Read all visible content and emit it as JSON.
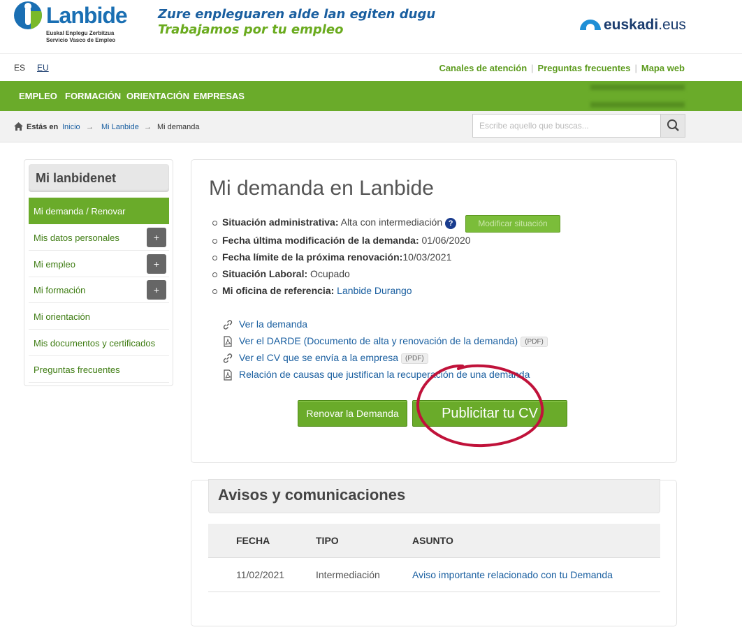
{
  "header": {
    "logo_word": "Lanbide",
    "logo_sub1": "Euskal Enplegu Zerbitzua",
    "logo_sub2": "Servicio Vasco de Empleo",
    "slogan_eu": "Zure enpleguaren alde lan egiten dugu",
    "slogan_es": "Trabajamos por tu empleo",
    "euskadi_bold": "euskadi",
    "euskadi_tld": ".eus"
  },
  "toplinks": {
    "lang_es": "ES",
    "lang_eu": "EU",
    "canales": "Canales de atención",
    "preguntas": "Preguntas frecuentes",
    "mapa": "Mapa web",
    "sep": "|"
  },
  "nav": {
    "items": [
      "EMPLEO",
      "FORMACIÓN",
      "ORIENTACIÓN",
      "EMPRESAS"
    ]
  },
  "breadcrumb": {
    "label": "Estás en",
    "items": [
      "Inicio",
      "Mi Lanbide",
      "Mi demanda"
    ],
    "arrow": "→"
  },
  "search": {
    "placeholder": "Escribe aquello que buscas..."
  },
  "sidebar": {
    "title": "Mi lanbidenet",
    "items": [
      {
        "label": "Mi demanda / Renovar"
      },
      {
        "label": "Mis datos personales",
        "expand": "+"
      },
      {
        "label": "Mi empleo",
        "expand": "+"
      },
      {
        "label": "Mi formación",
        "expand": "+"
      },
      {
        "label": "Mi orientación"
      },
      {
        "label": "Mis documentos y certificados"
      },
      {
        "label": "Preguntas frecuentes"
      }
    ]
  },
  "main": {
    "title": "Mi demanda en Lanbide",
    "info": [
      {
        "label": "Situación administrativa:",
        "value": " Alta con intermediación"
      },
      {
        "label": "Fecha última modificación de la demanda:",
        "value": " 01/06/2020"
      },
      {
        "label": "Fecha límite de la próxima renovación:",
        "value": "10/03/2021"
      },
      {
        "label": "Situación Laboral:",
        "value": " Ocupado"
      },
      {
        "label": "Mi oficina de referencia:",
        "value": " Lanbide Durango"
      }
    ],
    "help": "?",
    "modify_button": "Modificar situación",
    "links": [
      {
        "label": "Ver la demanda",
        "icon": "link-icon"
      },
      {
        "label": "Ver el DARDE (Documento de alta y renovación de la demanda)",
        "tag": "(PDF)",
        "icon": "pdf-icon"
      },
      {
        "label": "Ver el CV que se envía a la empresa",
        "tag": "(PDF)",
        "icon": "link-icon"
      },
      {
        "label": "Relación de causas que justifican la recuperación de una demanda",
        "icon": "pdf-icon"
      }
    ],
    "renovar_button": "Renovar la Demanda",
    "publicitar_button": "Publicitar tu CV"
  },
  "notices": {
    "title": "Avisos y comunicaciones",
    "headers": [
      "FECHA",
      "TIPO",
      "ASUNTO"
    ],
    "rows": [
      {
        "fecha": "11/02/2021",
        "tipo": "Intermediación",
        "asunto": "Aviso importante relacionado con tu Demanda"
      }
    ]
  },
  "colors": {
    "brand_green": "#6aab2a",
    "brand_blue": "#1a5fa0",
    "annotation_red": "#c0123a"
  }
}
